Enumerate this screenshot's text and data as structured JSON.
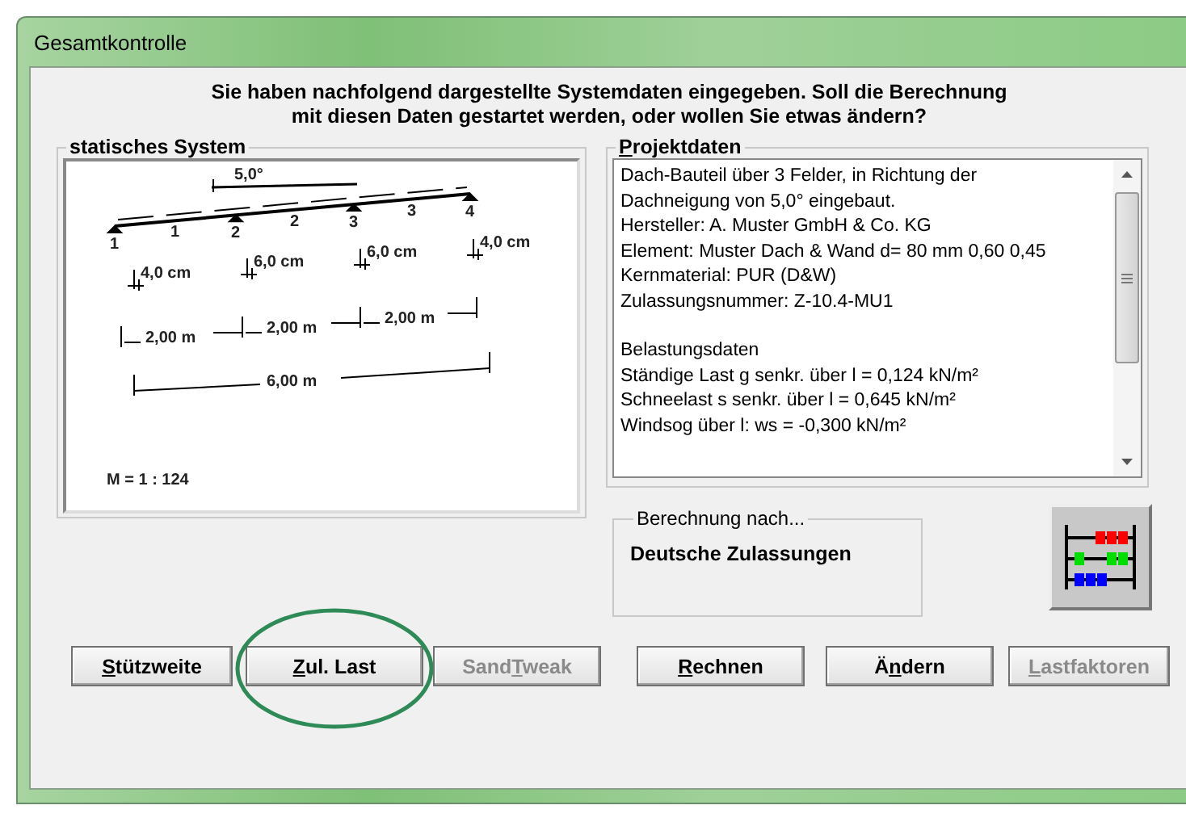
{
  "window": {
    "title": "Gesamtkontrolle"
  },
  "message": [
    "Sie haben nachfolgend dargestellte Systemdaten eingegeben. Soll die Berechnung",
    "mit diesen Daten gestartet werden, oder wollen Sie etwas ändern?"
  ],
  "system": {
    "title": "statisches System",
    "angle": "5,0°",
    "nodes": [
      "1",
      "2",
      "3",
      "4"
    ],
    "spans": [
      "1",
      "2",
      "3"
    ],
    "thicknesses": [
      "4,0 cm",
      "6,0 cm",
      "6,0 cm",
      "4,0 cm"
    ],
    "span_lengths": [
      "2,00 m",
      "2,00 m",
      "2,00 m"
    ],
    "total_length": "6,00 m",
    "scale": "M = 1 : 124"
  },
  "project": {
    "title": "Projektdaten",
    "paragraphs": [
      [
        "Dach-Bauteil über 3 Felder, in Richtung der",
        "Dachneigung von 5,0° eingebaut.",
        "Hersteller: A. Muster GmbH & Co. KG",
        "Element: Muster Dach & Wand d= 80 mm 0,60 0,45",
        "Kernmaterial: PUR (D&W)",
        "Zulassungsnummer: Z-10.4-MU1"
      ],
      [
        "Belastungsdaten",
        "Ständige Last g senkr. über l = 0,124 kN/m²",
        "Schneelast s senkr. über l = 0,645 kN/m²",
        "Windsog über l: ws = -0,300 kN/m²"
      ]
    ]
  },
  "calculation": {
    "title": "Berechnung nach...",
    "value": "Deutsche Zulassungen"
  },
  "buttons": [
    {
      "label": "Stützweite",
      "disabled": false,
      "highlighted": false
    },
    {
      "label": "Zul. Last",
      "disabled": false,
      "highlighted": true
    },
    {
      "label": "SandTweak",
      "disabled": true,
      "highlighted": false
    },
    {
      "label": "Rechnen",
      "disabled": false,
      "highlighted": false
    },
    {
      "label": "Ändern",
      "disabled": false,
      "highlighted": false
    },
    {
      "label": "Lastfaktoren",
      "disabled": true,
      "highlighted": false
    }
  ]
}
